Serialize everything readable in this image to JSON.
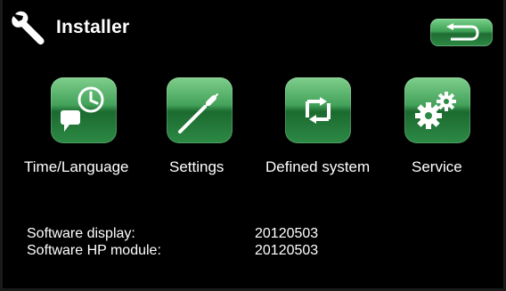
{
  "header": {
    "title": "Installer"
  },
  "menu": [
    {
      "label": "Time/Language",
      "icon": "clock-chat-icon"
    },
    {
      "label": "Settings",
      "icon": "screwdriver-icon"
    },
    {
      "label": "Defined system",
      "icon": "cycle-arrows-icon"
    },
    {
      "label": "Service",
      "icon": "gears-icon"
    }
  ],
  "info": {
    "rows": [
      {
        "label": "Software display:",
        "value": "20120503"
      },
      {
        "label": "Software HP module:",
        "value": "20120503"
      }
    ]
  },
  "colors": {
    "accent": "#2f8f45",
    "background": "#000000",
    "text": "#ffffff"
  }
}
